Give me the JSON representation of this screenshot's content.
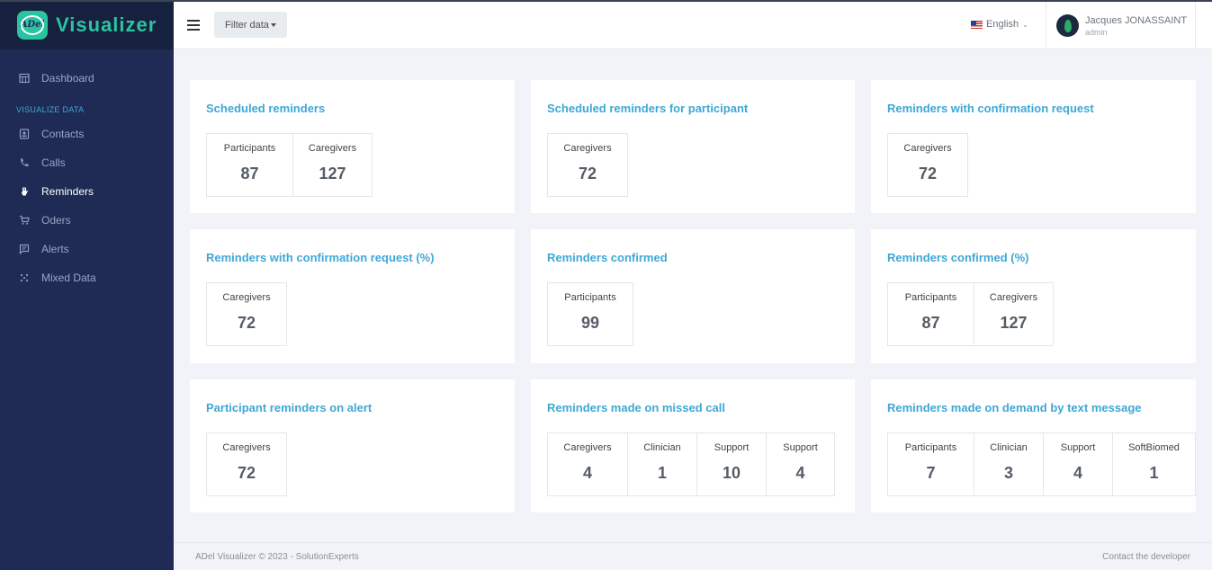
{
  "app": {
    "name": "Visualizer",
    "logo_text": "ADel"
  },
  "sidebar": {
    "dashboard": {
      "label": "Dashboard",
      "icon": "dashboard-icon"
    },
    "section_title": "VISUALIZE DATA",
    "items": [
      {
        "label": "Contacts",
        "icon": "contacts-icon",
        "active": false
      },
      {
        "label": "Calls",
        "icon": "phone-icon",
        "active": false
      },
      {
        "label": "Reminders",
        "icon": "hand-icon",
        "active": true
      },
      {
        "label": "Oders",
        "icon": "cart-icon",
        "active": false
      },
      {
        "label": "Alerts",
        "icon": "message-icon",
        "active": false
      },
      {
        "label": "Mixed Data",
        "icon": "grid-dots-icon",
        "active": false
      }
    ]
  },
  "header": {
    "filter_label": "Filter data",
    "language": "English",
    "user": {
      "name": "Jacques JONASSAINT",
      "role": "admin"
    }
  },
  "cards": [
    {
      "title": "Scheduled reminders",
      "stats": [
        {
          "label": "Participants",
          "value": "87"
        },
        {
          "label": "Caregivers",
          "value": "127"
        }
      ]
    },
    {
      "title": "Scheduled reminders for participant",
      "stats": [
        {
          "label": "Caregivers",
          "value": "72"
        }
      ]
    },
    {
      "title": "Reminders with confirmation request",
      "stats": [
        {
          "label": "Caregivers",
          "value": "72"
        }
      ]
    },
    {
      "title": "Reminders with confirmation request (%)",
      "stats": [
        {
          "label": "Caregivers",
          "value": "72"
        }
      ]
    },
    {
      "title": "Reminders confirmed",
      "stats": [
        {
          "label": "Participants",
          "value": "99"
        }
      ]
    },
    {
      "title": "Reminders confirmed (%)",
      "stats": [
        {
          "label": "Participants",
          "value": "87"
        },
        {
          "label": "Caregivers",
          "value": "127"
        }
      ]
    },
    {
      "title": "Participant reminders on alert",
      "stats": [
        {
          "label": "Caregivers",
          "value": "72"
        }
      ]
    },
    {
      "title": "Reminders made on missed call",
      "stats": [
        {
          "label": "Caregivers",
          "value": "4"
        },
        {
          "label": "Clinician",
          "value": "1"
        },
        {
          "label": "Support",
          "value": "10"
        },
        {
          "label": "Support",
          "value": "4"
        }
      ]
    },
    {
      "title": "Reminders made on demand by text message",
      "stats": [
        {
          "label": "Participants",
          "value": "7"
        },
        {
          "label": "Clinician",
          "value": "3"
        },
        {
          "label": "Support",
          "value": "4"
        },
        {
          "label": "SoftBiomed",
          "value": "1"
        }
      ]
    }
  ],
  "footer": {
    "copyright": "ADel Visualizer © 2023 - SolutionExperts",
    "contact": "Contact the developer"
  }
}
